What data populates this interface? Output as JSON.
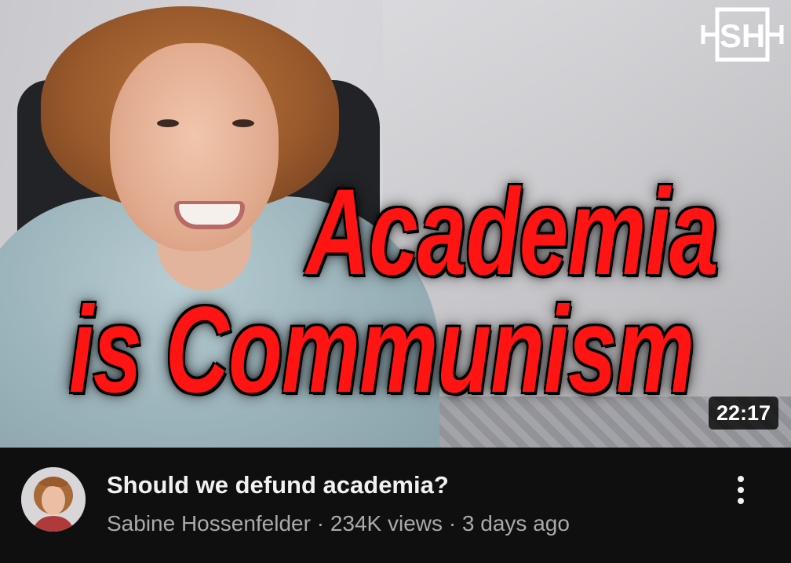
{
  "thumbnail": {
    "headline_line1": "Academia",
    "headline_line2": "is Communism",
    "duration": "22:17",
    "logo_text": "SH"
  },
  "video": {
    "title": "Should we defund academia?",
    "channel": "Sabine Hossenfelder",
    "separator": "·",
    "views": "234K views",
    "age": "3 days ago"
  },
  "icons": {
    "avatar": "channel-avatar",
    "menu": "more-vert-icon"
  },
  "colors": {
    "background": "#0f0f0f",
    "title": "#f1f1f1",
    "meta": "#aaaaaa",
    "headline": "#ff1414"
  }
}
